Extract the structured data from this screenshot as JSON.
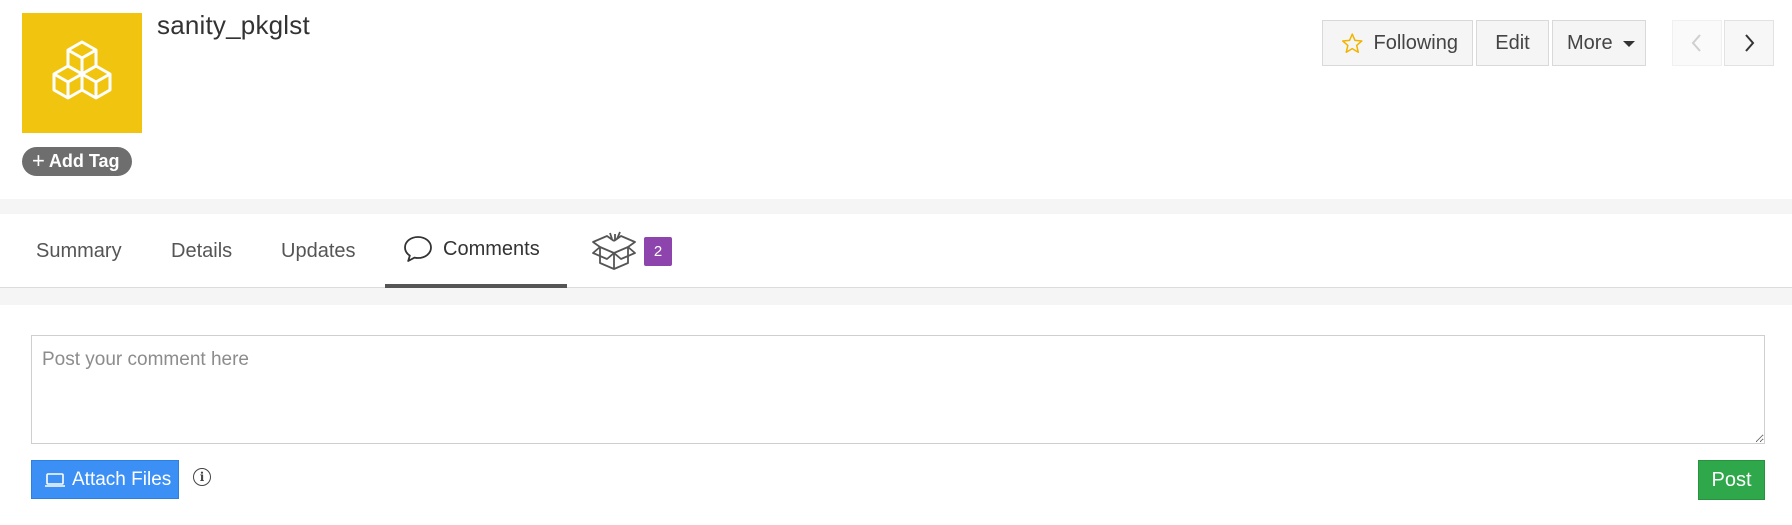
{
  "header": {
    "title": "sanity_pkglst",
    "logo_icon": "cubes-icon",
    "logo_color": "#f1c40f",
    "add_tag_label": "Add Tag",
    "actions": {
      "following_label": "Following",
      "edit_label": "Edit",
      "more_label": "More"
    }
  },
  "tabs": {
    "summary": "Summary",
    "details": "Details",
    "updates": "Updates",
    "comments": "Comments",
    "packages_count": "2",
    "active": "comments"
  },
  "comment": {
    "placeholder": "Post your comment here",
    "value": "",
    "attach_label": "Attach Files",
    "post_label": "Post"
  },
  "colors": {
    "badge": "#8e44ad",
    "attach_button": "#3b8ff5",
    "post_button": "#2ea84a",
    "tag_button": "#6e6e6e"
  }
}
